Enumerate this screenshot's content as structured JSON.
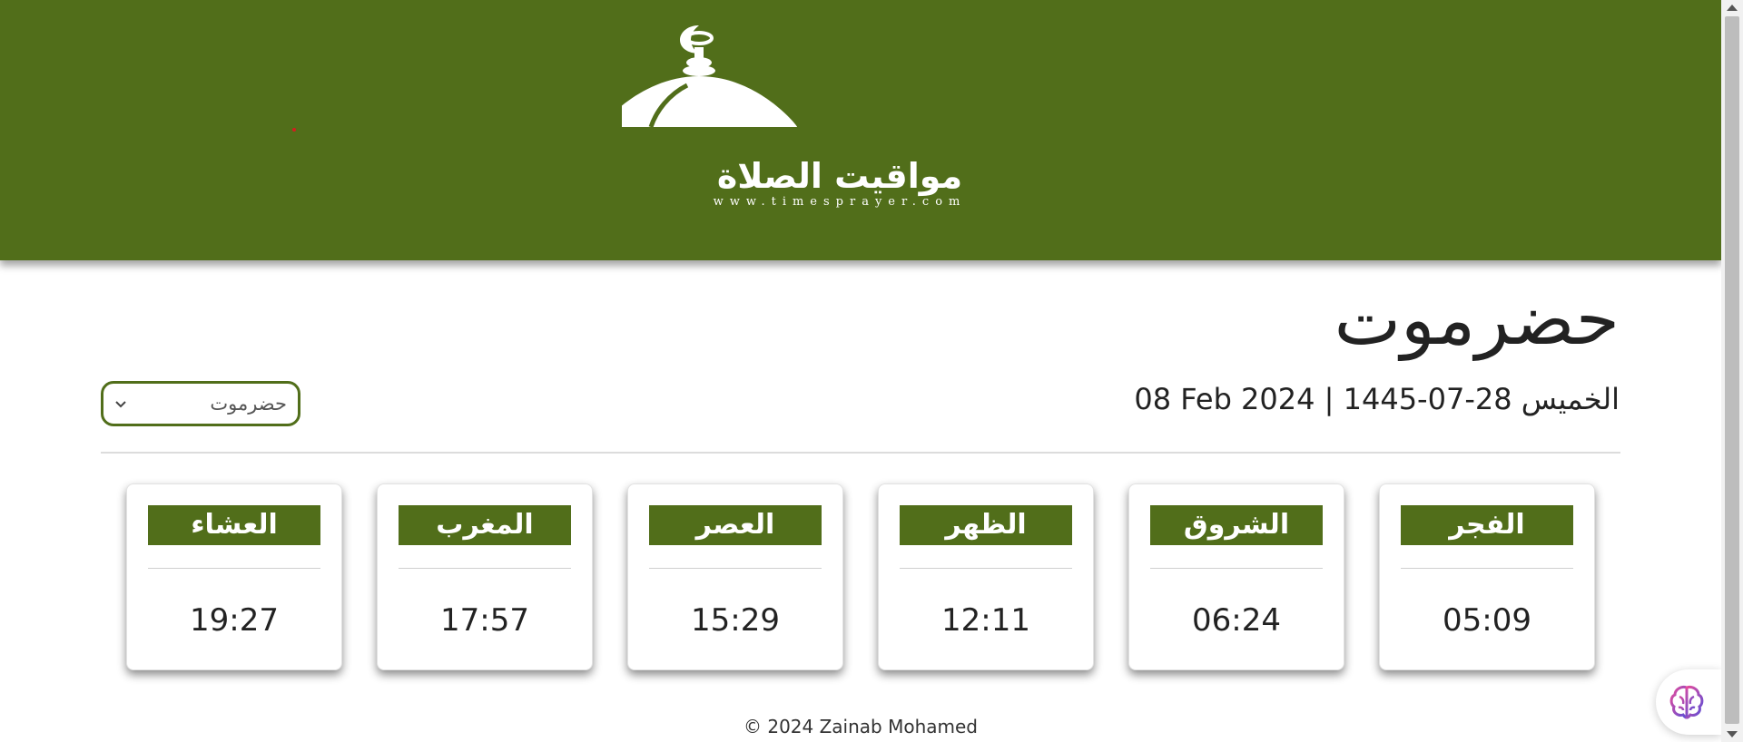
{
  "header": {
    "logo_text": "مواقيت الصلاة",
    "logo_url": "www.timesprayer.com",
    "background_color": "#516e1a"
  },
  "city": {
    "title": "حضرموت",
    "date": "08 Feb 2024 | الخميس 28-07-1445"
  },
  "city_select": {
    "value": "حضرموت"
  },
  "prayers": [
    {
      "name": "العشاء",
      "time": "19:27"
    },
    {
      "name": "المغرب",
      "time": "17:57"
    },
    {
      "name": "العصر",
      "time": "15:29"
    },
    {
      "name": "الظهر",
      "time": "12:11"
    },
    {
      "name": "الشروق",
      "time": "06:24"
    },
    {
      "name": "الفجر",
      "time": "05:09"
    }
  ],
  "footer": {
    "text": "© 2024 Zainab Mohamed"
  },
  "icons": {
    "logo": "mosque-dome-icon",
    "select": "chevron-down-icon",
    "assistant": "brain-icon"
  }
}
